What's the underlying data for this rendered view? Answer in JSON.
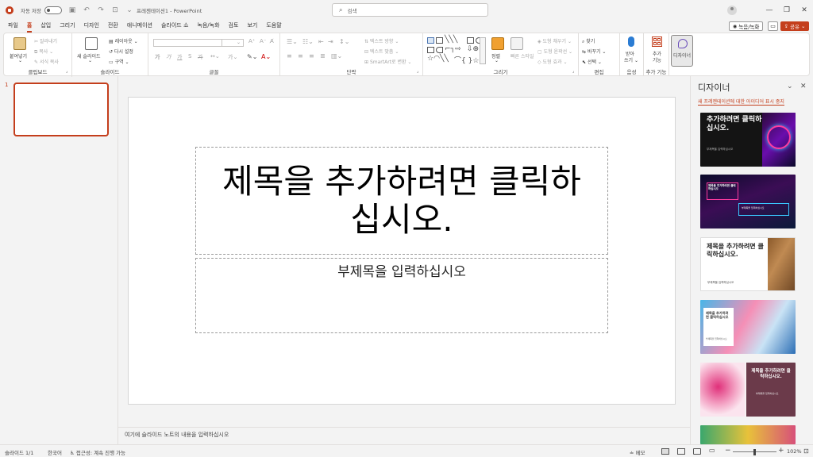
{
  "titlebar": {
    "autosave_label": "자동 저장",
    "autosave_state": "끔",
    "doc_title": "프레젠테이션1 - PowerPoint",
    "search_placeholder": "검색",
    "icons": [
      "save-icon",
      "undo-icon",
      "redo-icon",
      "start-from-beginning-icon",
      "customize-qat-icon"
    ]
  },
  "menu": {
    "tabs": [
      "파일",
      "홈",
      "삽입",
      "그리기",
      "디자인",
      "전환",
      "애니메이션",
      "슬라이드 쇼",
      "녹음/녹화",
      "검토",
      "보기",
      "도움말"
    ],
    "active": "홈",
    "record_label": "녹음/녹화",
    "share_label": "공유"
  },
  "ribbon": {
    "clipboard": {
      "label": "클립보드",
      "paste": "붙여넣기",
      "cut": "잘라내기",
      "copy": "복사",
      "format_painter": "서식 복사"
    },
    "slides": {
      "label": "슬라이드",
      "new_slide": "새 슬라이드",
      "layout": "레이아웃",
      "reset": "다시 설정",
      "section": "구역"
    },
    "font": {
      "label": "글꼴"
    },
    "paragraph": {
      "label": "단락",
      "text_direction": "텍스트 방향",
      "align_text": "텍스트 맞춤",
      "smartart": "SmartArt로 변환"
    },
    "drawing": {
      "label": "그리기",
      "arrange": "정렬",
      "quick_styles": "빠른 스타일",
      "shape_fill": "도형 채우기",
      "shape_outline": "도형 윤곽선",
      "shape_effects": "도형 효과"
    },
    "editing": {
      "label": "편집",
      "find": "찾기",
      "replace": "바꾸기",
      "select": "선택"
    },
    "voice": {
      "label": "음성",
      "dictate_1": "받아",
      "dictate_2": "쓰기"
    },
    "addins": {
      "label": "추가 기능",
      "addins_1": "추가",
      "addins_2": "기능"
    },
    "designer": {
      "label": "디자이너"
    }
  },
  "thumbnails": {
    "slide_number": "1"
  },
  "slide": {
    "title_line1": "제목을 추가하려면 클릭하",
    "title_line2": "십시오.",
    "subtitle": "부제목을 입력하십시오"
  },
  "notes_placeholder": "여기에 슬라이드 노트의 내용을 입력하십시오",
  "designer_pane": {
    "title": "디자이너",
    "link": "새 프레젠테이션에 대한 아이디어 표시 중지",
    "cards": [
      {
        "text": "추가하려면 클릭하십시오.",
        "sub": "부제목을 입력하십시오"
      },
      {
        "text": "제목을 추가하려면 클릭하십시오",
        "sub": "부제목을 입력하십시오"
      },
      {
        "text": "제목을 추가하려면 클릭하십시오.",
        "sub": "부제목을 입력하십시오"
      },
      {
        "text": "제목을 추가하려면 클릭하십시오",
        "sub": "부제목을 입력하십시오"
      },
      {
        "text": "제목을 추가하려면 클릭하십시오.",
        "sub": "부제목을 입력하십시오"
      }
    ]
  },
  "statusbar": {
    "slide_info": "슬라이드 1/1",
    "language": "한국어",
    "accessibility": "접근성: 계속 진행 가능",
    "notes": "메모",
    "zoom": "102%"
  },
  "colors": {
    "accent": "#c43e1c",
    "ribbon_bg": "#ffffff",
    "app_bg": "#f3f3f3"
  }
}
